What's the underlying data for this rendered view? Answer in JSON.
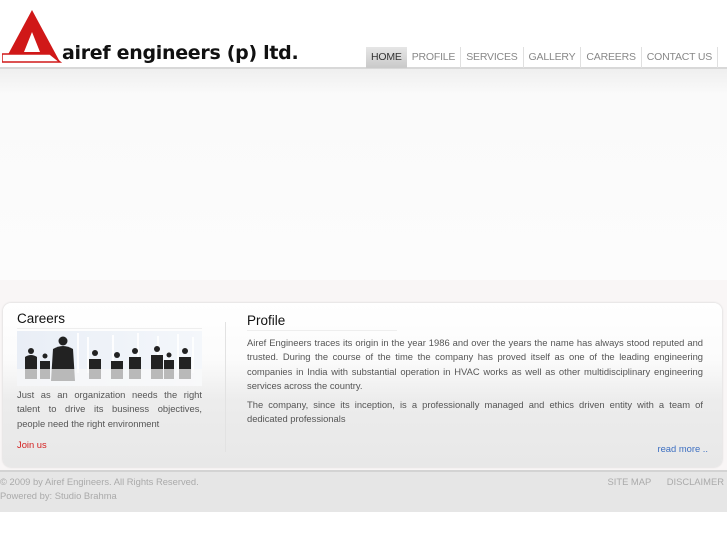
{
  "header": {
    "brand": "airef engineers (p) ltd.",
    "logo_letter": "A",
    "nav": [
      {
        "label": "HOME",
        "active": true
      },
      {
        "label": "PROFILE"
      },
      {
        "label": "SERVICES"
      },
      {
        "label": "GALLERY"
      },
      {
        "label": "CAREERS"
      },
      {
        "label": "CONTACT US"
      }
    ]
  },
  "careers": {
    "title": "Careers",
    "text": "Just as an organization needs the right talent to drive its business objectives, people need the right environment",
    "link": "Join us"
  },
  "profile": {
    "title": "Profile",
    "paragraphs": [
      "Airef Engineers traces its origin in the year 1986 and over the years the name has always stood reputed and trusted. During the course of the time the company has proved itself as one of the leading engineering companies in India with substantial operation in HVAC works as well as other multidisciplinary engineering services across the country.",
      "The company, since its inception, is a professionally managed and ethics driven entity with a team of dedicated professionals"
    ],
    "read_more": "read more .."
  },
  "footer": {
    "copyright": "© 2009 by Airef Engineers. All Rights Reserved.",
    "powered": "Powered by: Studio Brahma",
    "links": [
      "SITE MAP",
      "DISCLAIMER"
    ]
  },
  "colors": {
    "brand_red": "#d42020",
    "link_blue": "#3d6fc1"
  }
}
